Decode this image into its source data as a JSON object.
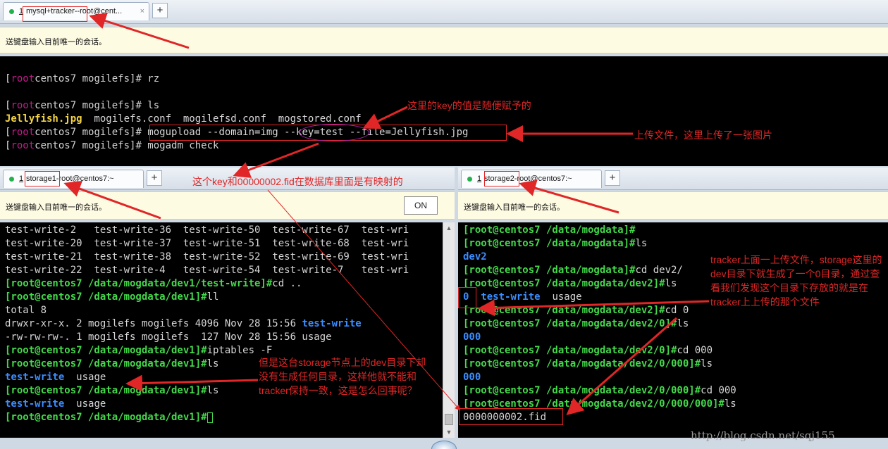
{
  "top_window": {
    "tab_number": "1",
    "tab_title": "mysql+tracker--root@cent...",
    "close": "×",
    "add_tab": "+",
    "notice": "送键盘输入目前唯一的会话。",
    "lines": [
      {
        "segments": [
          {
            "t": "[",
            "c": "w"
          },
          {
            "t": "root",
            "c": "r"
          },
          {
            "t": "centos7 mogilefs]# rz",
            "c": "w"
          }
        ]
      },
      {
        "segments": [
          {
            "t": "[",
            "c": "w"
          },
          {
            "t": "root",
            "c": "r"
          },
          {
            "t": "centos7 mogilefs]# ls",
            "c": "w"
          }
        ]
      },
      {
        "segments": [
          {
            "t": "Jellyfish.jpg",
            "c": "y"
          },
          {
            "t": "  mogilefs.conf  mogilefsd.conf  mogstored.conf",
            "c": "w"
          }
        ]
      },
      {
        "segments": [
          {
            "t": "[",
            "c": "w"
          },
          {
            "t": "root",
            "c": "r"
          },
          {
            "t": "centos7 mogilefs]# mogupload --domain=img --key=test --file=Jellyfish.jpg",
            "c": "w"
          }
        ]
      },
      {
        "segments": [
          {
            "t": "[",
            "c": "w"
          },
          {
            "t": "root",
            "c": "r"
          },
          {
            "t": "centos7 mogilefs]# mogadm check",
            "c": "w"
          }
        ]
      }
    ]
  },
  "storage1": {
    "tab_number": "1",
    "tab_title": "storage1-root@centos7:~",
    "add_tab": "+",
    "notice": "送键盘输入目前唯一的会话。",
    "on_button": "ON",
    "lines": [
      {
        "segments": [
          {
            "t": "test-write-2   test-write-36  test-write-50  test-write-67  test-wri",
            "c": "w"
          }
        ]
      },
      {
        "segments": [
          {
            "t": "test-write-20  test-write-37  test-write-51  test-write-68  test-wri",
            "c": "w"
          }
        ]
      },
      {
        "segments": [
          {
            "t": "test-write-21  test-write-38  test-write-52  test-write-69  test-wri",
            "c": "w"
          }
        ]
      },
      {
        "segments": [
          {
            "t": "test-write-22  test-write-4   test-write-54  test-write-7   test-wri",
            "c": "w"
          }
        ]
      },
      {
        "segments": [
          {
            "t": "[root@centos7 /data/mogdata/dev1/test-write]#",
            "c": "g"
          },
          {
            "t": "cd ..",
            "c": "w"
          }
        ]
      },
      {
        "segments": [
          {
            "t": "[root@centos7 /data/mogdata/dev1]#",
            "c": "g"
          },
          {
            "t": "ll",
            "c": "w"
          }
        ]
      },
      {
        "segments": [
          {
            "t": "total 8",
            "c": "w"
          }
        ]
      },
      {
        "segments": [
          {
            "t": "drwxr-xr-x. 2 mogilefs mogilefs 4096 Nov 28 15:56 ",
            "c": "w"
          },
          {
            "t": "test-write",
            "c": "b"
          }
        ]
      },
      {
        "segments": [
          {
            "t": "-rw-rw-rw-. 1 mogilefs mogilefs  127 Nov 28 15:56 usage",
            "c": "w"
          }
        ]
      },
      {
        "segments": [
          {
            "t": "[root@centos7 /data/mogdata/dev1]#",
            "c": "g"
          },
          {
            "t": "iptables -F",
            "c": "w"
          }
        ]
      },
      {
        "segments": [
          {
            "t": "[root@centos7 /data/mogdata/dev1]#",
            "c": "g"
          },
          {
            "t": "ls",
            "c": "w"
          }
        ]
      },
      {
        "segments": [
          {
            "t": "test-write",
            "c": "b"
          },
          {
            "t": "  usage",
            "c": "w"
          }
        ]
      },
      {
        "segments": [
          {
            "t": "[root@centos7 /data/mogdata/dev1]#",
            "c": "g"
          },
          {
            "t": "ls",
            "c": "w"
          }
        ]
      },
      {
        "segments": [
          {
            "t": "test-write",
            "c": "b"
          },
          {
            "t": "  usage",
            "c": "w"
          }
        ]
      },
      {
        "segments": [
          {
            "t": "[root@centos7 /data/mogdata/dev1]#",
            "c": "g"
          }
        ]
      }
    ]
  },
  "storage2": {
    "tab_number": "1",
    "tab_title": "storage2-root@centos7:~",
    "add_tab": "+",
    "notice": "送键盘输入目前唯一的会话。",
    "lines": [
      {
        "segments": [
          {
            "t": "[root@centos7 /data/mogdata]#",
            "c": "g"
          }
        ]
      },
      {
        "segments": [
          {
            "t": "[root@centos7 /data/mogdata]#",
            "c": "g"
          },
          {
            "t": "ls",
            "c": "w"
          }
        ]
      },
      {
        "segments": [
          {
            "t": "dev2",
            "c": "b"
          }
        ]
      },
      {
        "segments": [
          {
            "t": "[root@centos7 /data/mogdata]#",
            "c": "g"
          },
          {
            "t": "cd dev2/",
            "c": "w"
          }
        ]
      },
      {
        "segments": [
          {
            "t": "[root@centos7 /data/mogdata/dev2]#",
            "c": "g"
          },
          {
            "t": "ls",
            "c": "w"
          }
        ]
      },
      {
        "segments": [
          {
            "t": "0",
            "c": "b"
          },
          {
            "t": "  ",
            "c": "w"
          },
          {
            "t": "test-write",
            "c": "b"
          },
          {
            "t": "  usage",
            "c": "w"
          }
        ]
      },
      {
        "segments": [
          {
            "t": "[root@centos7 /data/mogdata/dev2]#",
            "c": "g"
          },
          {
            "t": "cd 0",
            "c": "w"
          }
        ]
      },
      {
        "segments": [
          {
            "t": "[root@centos7 /data/mogdata/dev2/0]#",
            "c": "g"
          },
          {
            "t": "ls",
            "c": "w"
          }
        ]
      },
      {
        "segments": [
          {
            "t": "000",
            "c": "b"
          }
        ]
      },
      {
        "segments": [
          {
            "t": "[root@centos7 /data/mogdata/dev2/0]#",
            "c": "g"
          },
          {
            "t": "cd 000",
            "c": "w"
          }
        ]
      },
      {
        "segments": [
          {
            "t": "[root@centos7 /data/mogdata/dev2/0/000]#",
            "c": "g"
          },
          {
            "t": "ls",
            "c": "w"
          }
        ]
      },
      {
        "segments": [
          {
            "t": "000",
            "c": "b"
          }
        ]
      },
      {
        "segments": [
          {
            "t": "[root@centos7 /data/mogdata/dev2/0/000]#",
            "c": "g"
          },
          {
            "t": "cd 000",
            "c": "w"
          }
        ]
      },
      {
        "segments": [
          {
            "t": "[root@centos7 /data/mogdata/dev2/0/000/000]#",
            "c": "g"
          },
          {
            "t": "ls",
            "c": "w"
          }
        ]
      },
      {
        "segments": [
          {
            "t": "0000000002.fid",
            "c": "w"
          }
        ]
      }
    ]
  },
  "annotations": {
    "key_note": "这里的key的值是随便赋予的",
    "upload_note": "上传文件，这里上传了一张图片",
    "mapping_note": "这个key和00000002.fid在数据库里面是有映射的",
    "tracker_note": "tracker上面一上传文件，storage这里的dev目录下就生成了一个0目录，通过查看我们发现这个目录下存放的就是在tracker上上传的那个文件",
    "storage1_note": "但是这台storage节点上的dev目录下却没有生成任何目录，这样他就不能和tracker保持一致，这是怎么回事呢？"
  },
  "watermark": "http://blog.csdn.net/sqj155"
}
